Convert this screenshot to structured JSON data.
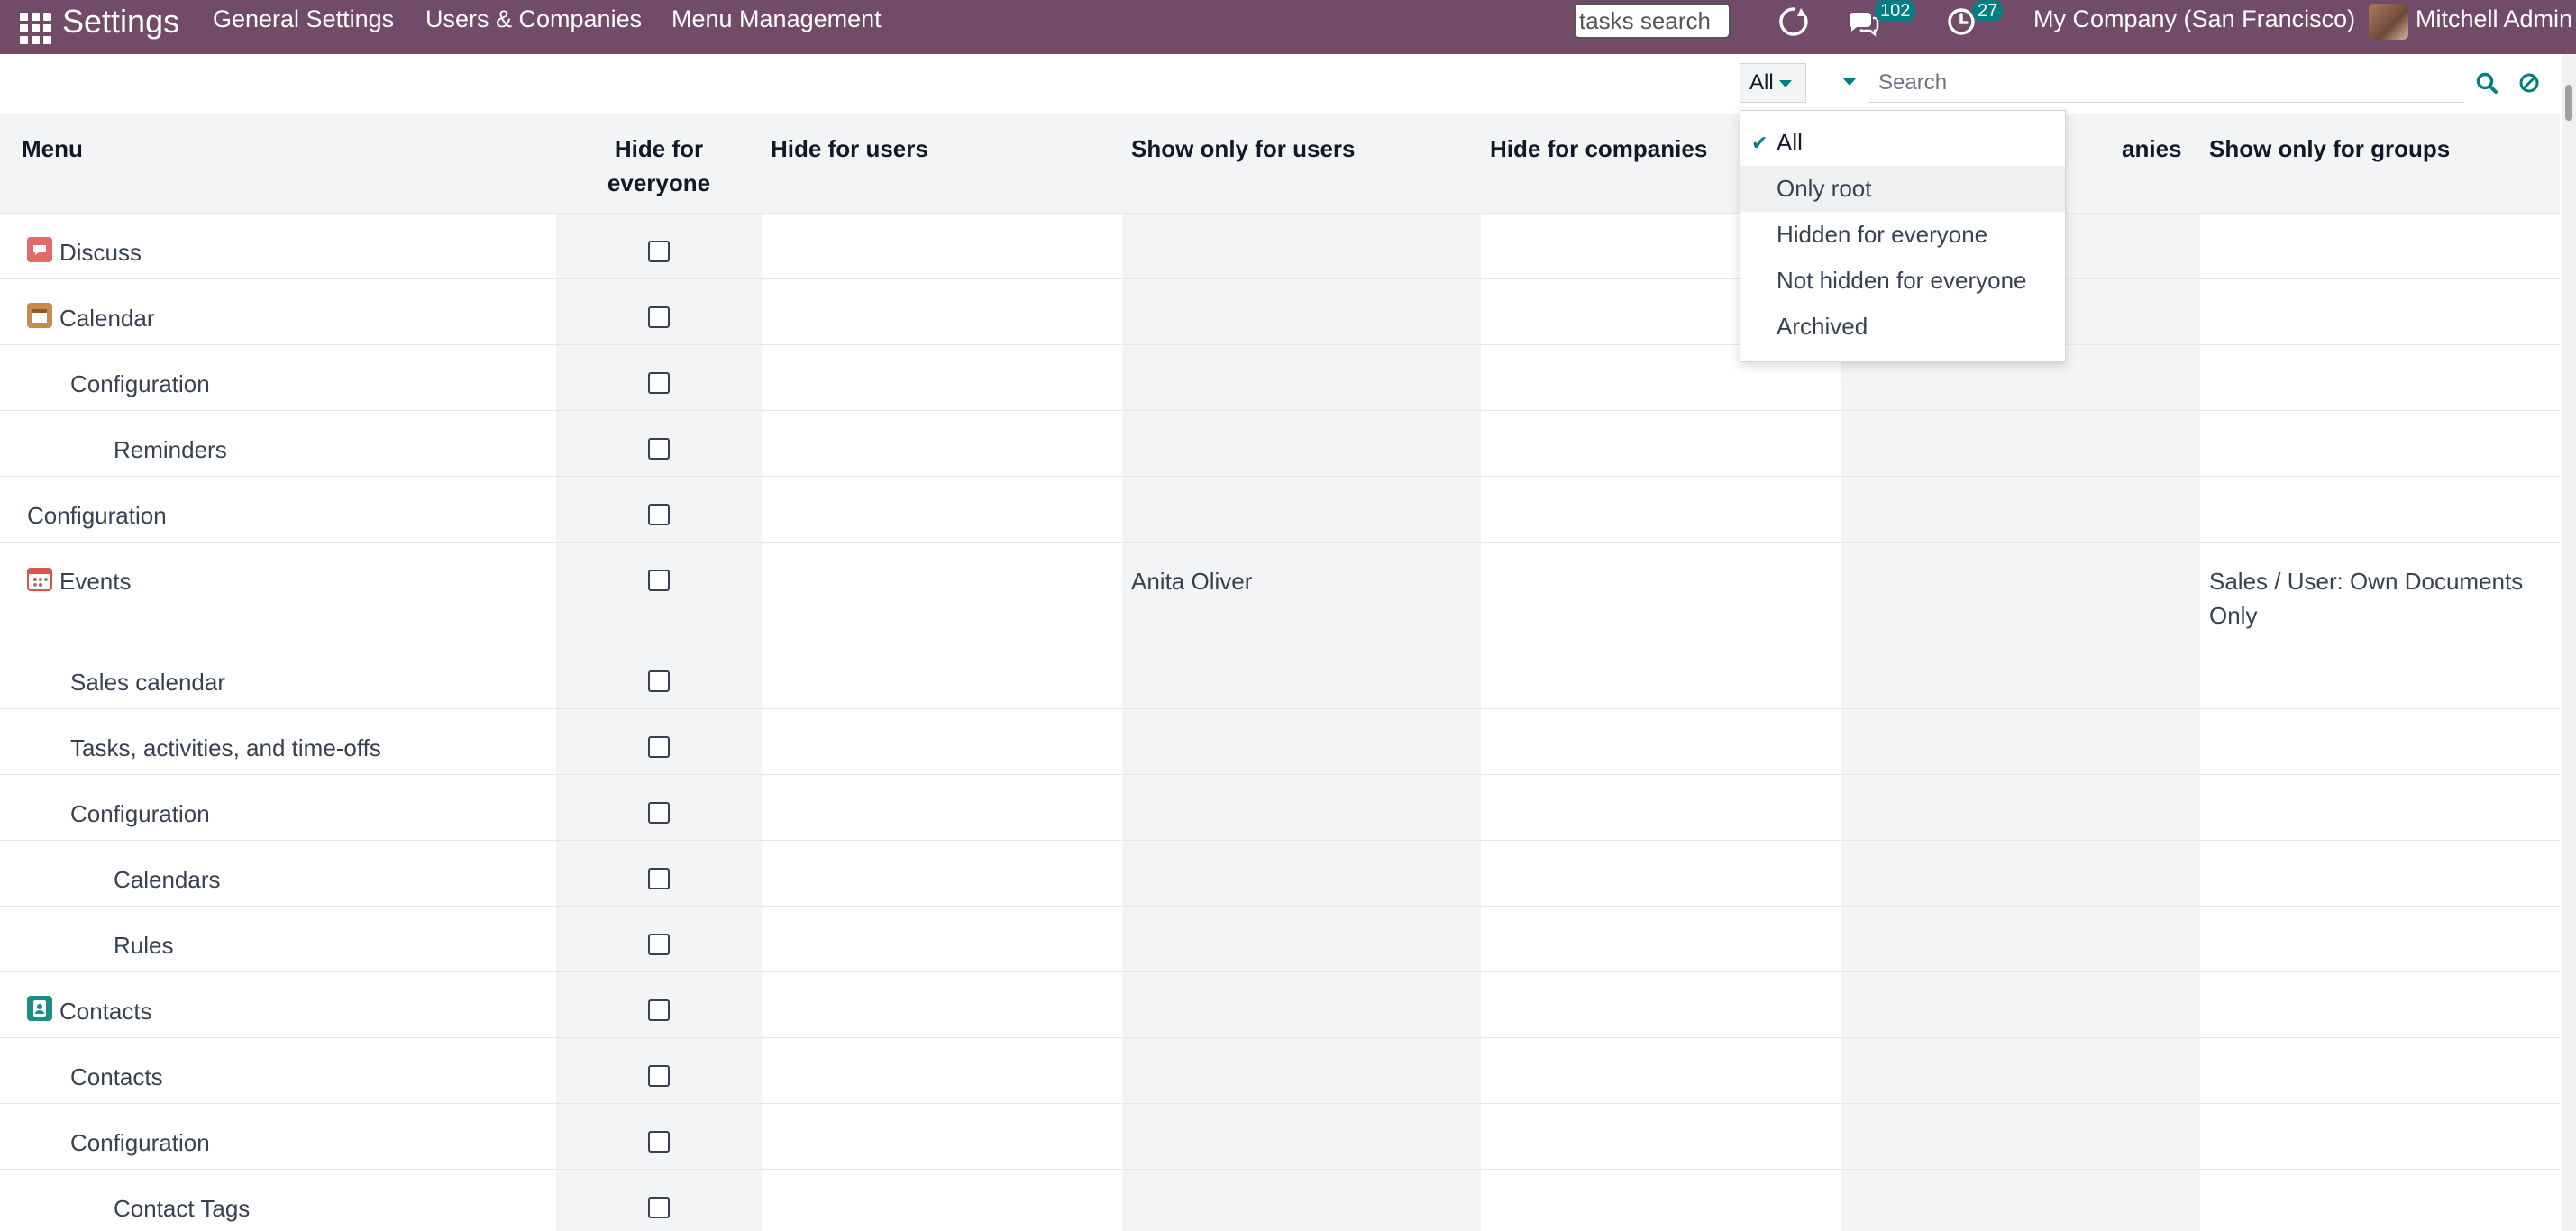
{
  "navbar": {
    "app_title": "Settings",
    "menus": [
      "General Settings",
      "Users & Companies",
      "Menu Management"
    ],
    "tasks_search_value": "tasks search",
    "chat_badge": "102",
    "activity_badge": "27",
    "company": "My Company (San Francisco)",
    "user": "Mitchell Admin"
  },
  "controls": {
    "filter_value": "All",
    "search_placeholder": "Search"
  },
  "table": {
    "headers": {
      "menu": "Menu",
      "hide_everyone": "Hide for everyone",
      "hide_users": "Hide for users",
      "show_users": "Show only for users",
      "hide_companies": "Hide for companies",
      "show_companies": "anies",
      "show_groups": "Show only for groups"
    },
    "rows": [
      {
        "label": "Discuss",
        "icon": "discuss-icon",
        "show_users": "",
        "show_groups": ""
      },
      {
        "label": "Calendar",
        "icon": "calendar-icon",
        "show_users": "",
        "show_groups": ""
      },
      {
        "label": "Configuration",
        "show_users": "",
        "show_groups": ""
      },
      {
        "label": "Reminders",
        "show_users": "",
        "show_groups": ""
      },
      {
        "label": "Configuration",
        "show_users": "",
        "show_groups": ""
      },
      {
        "label": "Events",
        "icon": "events-icon",
        "show_users": "Anita Oliver",
        "show_groups": "Sales / User: Own Documents Only"
      },
      {
        "label": "Sales calendar",
        "show_users": "",
        "show_groups": ""
      },
      {
        "label": "Tasks, activities, and time-offs",
        "show_users": "",
        "show_groups": ""
      },
      {
        "label": "Configuration",
        "show_users": "",
        "show_groups": ""
      },
      {
        "label": "Calendars",
        "show_users": "",
        "show_groups": ""
      },
      {
        "label": "Rules",
        "show_users": "",
        "show_groups": ""
      },
      {
        "label": "Contacts",
        "icon": "contacts-icon",
        "show_users": "",
        "show_groups": ""
      },
      {
        "label": "Contacts",
        "show_users": "",
        "show_groups": ""
      },
      {
        "label": "Configuration",
        "show_users": "",
        "show_groups": ""
      },
      {
        "label": "Contact Tags",
        "show_users": "",
        "show_groups": ""
      }
    ]
  },
  "dropdown": {
    "items": [
      "All",
      "Only root",
      "Hidden for everyone",
      "Not hidden for everyone",
      "Archived"
    ],
    "selected": "All",
    "hovered": "Only root"
  },
  "colors": {
    "brand": "#714b67",
    "accent": "#017e84"
  }
}
